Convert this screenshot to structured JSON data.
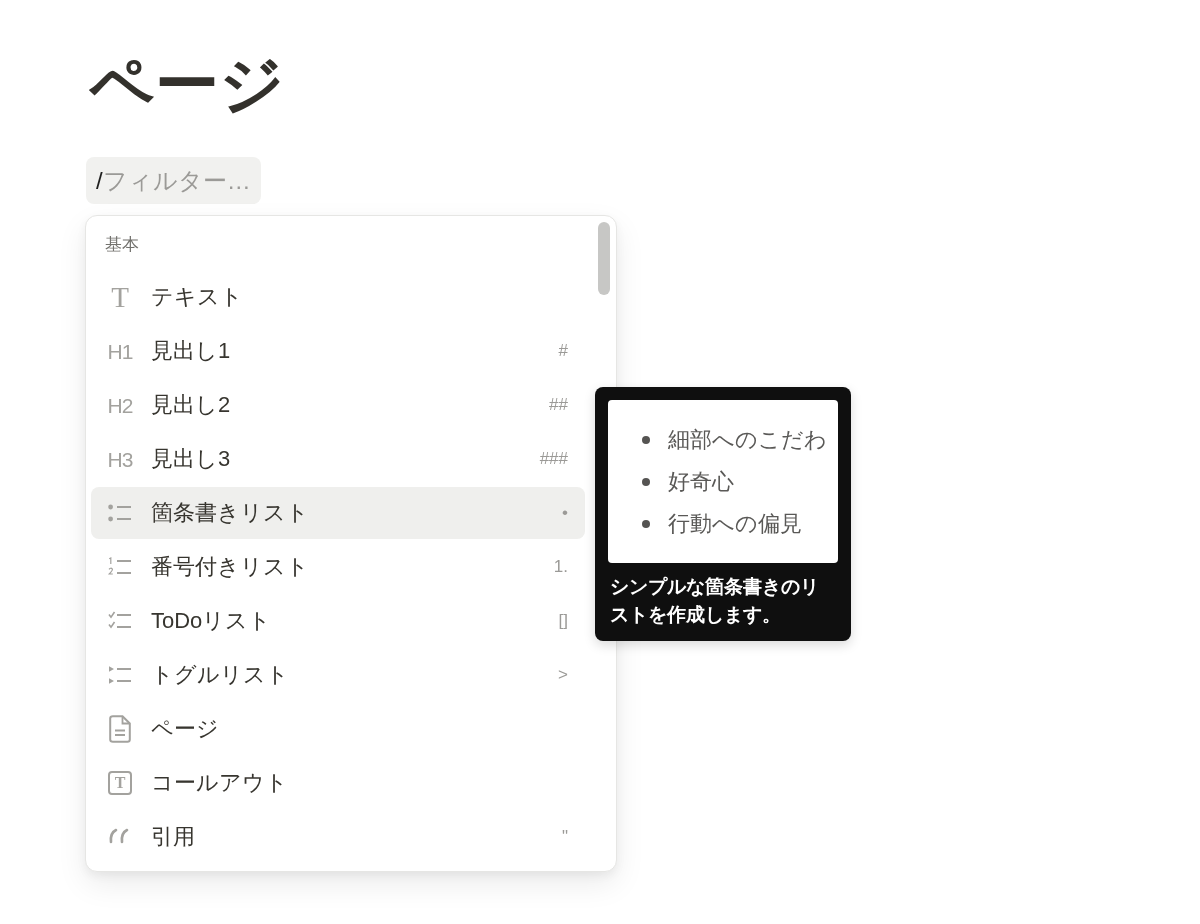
{
  "page": {
    "title": "ページ"
  },
  "filter_field": {
    "value": "/",
    "placeholder": "フィルター…"
  },
  "menu": {
    "section": "基本",
    "items": [
      {
        "kind": "text",
        "glyph": "T",
        "label": "テキスト",
        "selected": false
      },
      {
        "kind": "heading",
        "glyph": "H1",
        "label": "見出し1",
        "shortcut": "#",
        "selected": false
      },
      {
        "kind": "heading",
        "glyph": "H2",
        "label": "見出し2",
        "shortcut": "##",
        "selected": false
      },
      {
        "kind": "heading",
        "glyph": "H3",
        "label": "見出し3",
        "shortcut": "###",
        "selected": false
      },
      {
        "kind": "bulleted",
        "label": "箇条書きリスト",
        "shortcut": "•",
        "selected": true
      },
      {
        "kind": "numbered",
        "label": "番号付きリスト",
        "shortcut": "1.",
        "selected": false
      },
      {
        "kind": "todo",
        "label": "ToDoリスト",
        "shortcut": "[]",
        "selected": false
      },
      {
        "kind": "toggle",
        "label": "トグルリスト",
        "shortcut": ">",
        "selected": false
      },
      {
        "kind": "page",
        "label": "ページ",
        "selected": false
      },
      {
        "kind": "callout",
        "glyph": "T",
        "label": "コールアウト",
        "selected": false
      },
      {
        "kind": "quote",
        "label": "引用",
        "shortcut": "\"",
        "selected": false
      }
    ]
  },
  "tooltip": {
    "preview_items": [
      "細部へのこだわ",
      "好奇心",
      "行動への偏見"
    ],
    "description": "シンプルな箇条書きのリストを作成します。"
  }
}
